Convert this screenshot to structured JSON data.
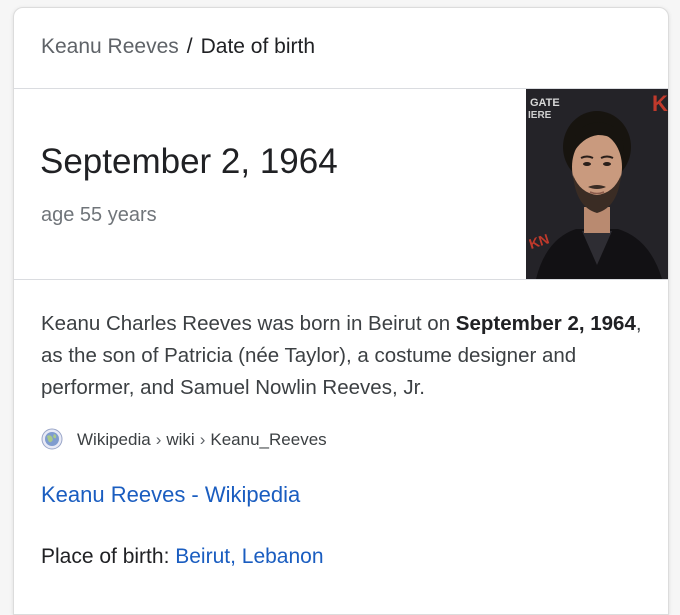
{
  "breadcrumb": {
    "entity": "Keanu Reeves",
    "separator": "/",
    "attribute": "Date of birth"
  },
  "answer": {
    "value": "September 2, 1964",
    "subtext": "age 55 years",
    "photo_backdrop_text": [
      "GATE",
      "IERE",
      "K",
      "KN"
    ]
  },
  "description": {
    "before": "Keanu Charles Reeves was born in Beirut on ",
    "bold": "September 2, 1964",
    "after": ", as the son of Patricia (née Taylor), a costume designer and performer, and Samuel Nowlin Reeves, Jr."
  },
  "source": {
    "site": "Wikipedia",
    "path": [
      "wiki",
      "Keanu_Reeves"
    ],
    "separator": "›"
  },
  "link": {
    "title": "Keanu Reeves - Wikipedia"
  },
  "fact": {
    "label": "Place of birth: ",
    "value": "Beirut, Lebanon"
  },
  "colors": {
    "link": "#1a5dc0",
    "primary_text": "#202124",
    "secondary_text": "#70757a",
    "divider": "#dadce0"
  }
}
